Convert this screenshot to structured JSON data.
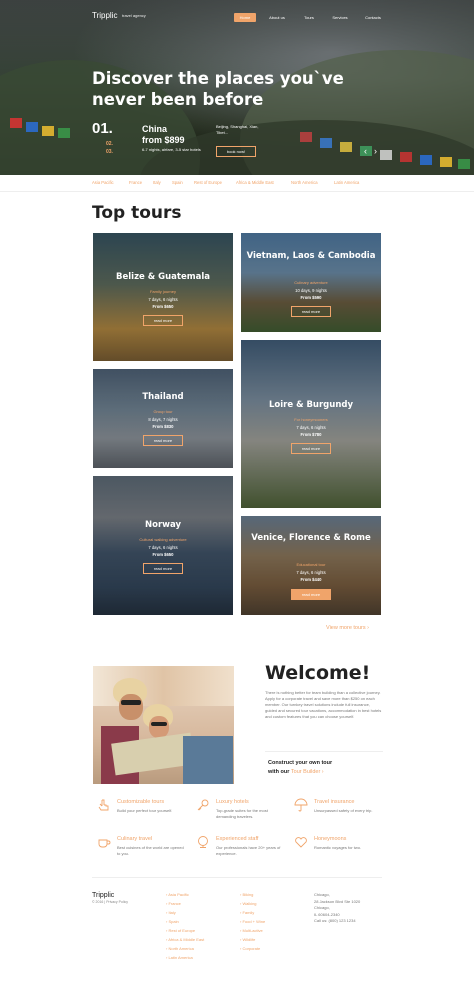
{
  "header": {
    "logo": "Tripplic",
    "tagline": "travel agency",
    "nav": [
      "Home",
      "About us",
      "Tours",
      "Services",
      "Contacts"
    ]
  },
  "hero": {
    "title": "Discover the places you`ve never been before",
    "slide_current": "01.",
    "slide_next": [
      "02.",
      "03."
    ],
    "destination": "China",
    "price": "from $899",
    "desc": "6-7 nights, airfare, 3-5 star hotels",
    "cities": "Beijing, Shanghai, Xian, Tibet...",
    "book_label": "book now!",
    "prev_arrow": "‹",
    "next_arrow": "›"
  },
  "filters": [
    "Asia Pacific",
    "France",
    "Italy",
    "Spain",
    "Rest of Europe",
    "Africa & Middle East",
    "North America",
    "Latin America"
  ],
  "top_tours": {
    "title": "Top tours",
    "cards": [
      {
        "title": "Belize & Guatemala",
        "sub": "Family journey",
        "nights": "7 days, 6 nights",
        "price": "From $650",
        "btn": "read more"
      },
      {
        "title": "Vietnam, Laos & Cambodia",
        "sub": "Culinary adventure",
        "nights": "10 days, 9 nights",
        "price": "From $590",
        "btn": "read more"
      },
      {
        "title": "Thailand",
        "sub": "Group tour",
        "nights": "8 days, 7 nights",
        "price": "From $830",
        "btn": "read more"
      },
      {
        "title": "Loire & Burgundy",
        "sub": "For honeymooners",
        "nights": "7 days, 6 nights",
        "price": "From $780",
        "btn": "read more"
      },
      {
        "title": "Norway",
        "sub": "Cultural walking adventure",
        "nights": "7 days, 6 nights",
        "price": "From $650",
        "btn": "read more"
      },
      {
        "title": "Venice, Florence & Rome",
        "sub": "Educational tour",
        "nights": "7 days, 6 nights",
        "price": "From $440",
        "btn": "read more"
      }
    ],
    "view_more": "View more tours ›"
  },
  "welcome": {
    "title": "Welcome!",
    "text": "There is nothing better for team building than a collective journey. Apply for a corporate travel and save more than $250 on each member. Our turnkey travel solutions include full insurance, guided and secured tour vacations, accommodation in best hotels and custom features that you can choose yourself.",
    "construct_line1": "Construct your own tour",
    "construct_line2": "with our",
    "construct_link": "Tour Builder ›"
  },
  "features": [
    {
      "icon": "hand-pointer-icon",
      "title": "Customizable tours",
      "desc": "Build your perfect tour yourself."
    },
    {
      "icon": "key-icon",
      "title": "Luxury hotels",
      "desc": "Top-grade suites for the most demanding travelers."
    },
    {
      "icon": "umbrella-icon",
      "title": "Travel insurance",
      "desc": "Unsurpassed safety of every trip."
    },
    {
      "icon": "cup-icon",
      "title": "Culinary travel",
      "desc": "Best cuisines of the world are opened to you."
    },
    {
      "icon": "globe-icon",
      "title": "Experienced staff",
      "desc": "Our professionals have 20+ years of experience."
    },
    {
      "icon": "heart-icon",
      "title": "Honeymoons",
      "desc": "Romantic voyages for two."
    }
  ],
  "footer": {
    "logo": "Tripplic",
    "copy": "© 2016 | Privacy Policy",
    "col1": [
      "Asia Pacific",
      "France",
      "Italy",
      "Spain",
      "Rest of Europe",
      "Africa & Middle East",
      "North America",
      "Latin America"
    ],
    "col2": [
      "Biking",
      "Walking",
      "Family",
      "Food + Wine",
      "Multi-active",
      "Wildlife",
      "Corporate"
    ],
    "address": [
      "Chicago,",
      "28 Jackson Blvd Ste 1020",
      "Chicago,",
      "IL 60604-2340",
      "Call us: (800) 123 1234"
    ]
  },
  "colors": {
    "accent": "#f0a46a",
    "text": "#222222",
    "muted": "#777777"
  }
}
